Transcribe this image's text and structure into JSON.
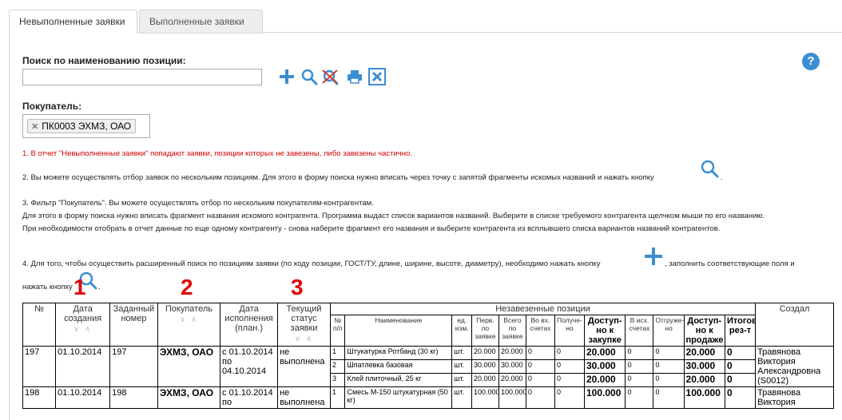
{
  "tabs": [
    "Невыполненные заявки",
    "Выполненные заявки"
  ],
  "search": {
    "label": "Поиск по наименованию позиции:",
    "value": "",
    "placeholder": ""
  },
  "buyer": {
    "label": "Покупатель:",
    "chip": "ПК0003 ЭХМЗ, ОАО"
  },
  "notes": {
    "n1": "1. В отчет \"Невыполненные заявки\" попадают заявки, позиции которых не завезены, либо завезены частично.",
    "n2": "2. Вы можете осуществлять отбор заявок по нескольким позициям. Для этого в форму поиска нужно вписать через точку с запятой фрагменты искомых названий и нажать кнопку",
    "n3a": "3. Фильтр \"Покупатель\". Вы можете осуществлять отбор по нескольким покупателям-контрагентам.",
    "n3b": "Для этого в форму поиска нужно вписать фрагмент названия искомого контрагента. Программа выдаст список вариантов названий. Выберите в списке требуемого контрагента щелчком мыши по его названию.",
    "n3c": "При необходимости отобрать в отчет данные по еще одному контрагенту - снова наберите фрагмент его названия и выберите контрагента из всплывшего списка вариантов названий контрагентов.",
    "n4a": "4. Для того, чтобы осуществить расширенный поиск по позициям заявки (по коду позиции, ГОСТ/ТУ, длине, ширине, высоте, диаметру), необходимо нажать кнопку",
    "n4b": ", заполнить соответствующие поля и",
    "n4c": "нажать кнопку",
    "dot": "."
  },
  "annotations": [
    "1",
    "2",
    "3"
  ],
  "table": {
    "headers": {
      "num": "№",
      "created": "Дата создания",
      "number": "Заданный номер",
      "buyer": "Покупатель",
      "exec_date": "Дата исполнения (план.)",
      "status": "Текущий статус заявки",
      "group": "Незавезенные позиции",
      "author": "Создал",
      "pp": "№ п/п",
      "name": "Наименование",
      "unit": "ед. изм.",
      "first_req": "Перв. по заявке",
      "total_req": "Всего по заявке",
      "in_invoice": "Во вх. счетах",
      "received": "Получе- но",
      "avail_buy": "Доступ- но к закупке",
      "out_invoice": "В исх. счетах",
      "shipped": "Отгруже- но",
      "avail_sell": "Доступ- но к продаже",
      "final_res": "Итоговый рез-т"
    },
    "sort_glyph": "∨ ∧",
    "orders": [
      {
        "num": "197",
        "created": "01.10.2014",
        "number": "197",
        "buyer": "ЭХМЗ, ОАО",
        "exec_date": "с 01.10.2014 по 04.10.2014",
        "status": "не выполнена",
        "author": "Травянова Виктория Александровна (S0012)",
        "items": [
          {
            "pp": "1",
            "name": "Штукатурка Ротбанд (30 кг)",
            "unit": "шт.",
            "first_req": "20.000",
            "total_req": "20.000",
            "in_invoice": "0",
            "received": "0",
            "avail_buy": "20.000",
            "out_invoice": "0",
            "shipped": "0",
            "avail_sell": "20.000",
            "final_res": "0"
          },
          {
            "pp": "2",
            "name": "Шпатлевка базовая",
            "unit": "шт.",
            "first_req": "30.000",
            "total_req": "30.000",
            "in_invoice": "0",
            "received": "0",
            "avail_buy": "30.000",
            "out_invoice": "0",
            "shipped": "0",
            "avail_sell": "30.000",
            "final_res": "0"
          },
          {
            "pp": "3",
            "name": "Клей плиточный, 25 кг",
            "unit": "шт.",
            "first_req": "20.000",
            "total_req": "20.000",
            "in_invoice": "0",
            "received": "0",
            "avail_buy": "20.000",
            "out_invoice": "0",
            "shipped": "0",
            "avail_sell": "20.000",
            "final_res": "0"
          }
        ]
      },
      {
        "num": "198",
        "created": "01.10.2014",
        "number": "198",
        "buyer": "ЭХМЗ, ОАО",
        "exec_date": "с 01.10.2014 по",
        "status": "не выполнена",
        "author": "Травянова Виктория",
        "items": [
          {
            "pp": "1",
            "name": "Смесь М-150 штукатурная (50 кг)",
            "unit": "шт.",
            "first_req": "100.000",
            "total_req": "100.000",
            "in_invoice": "0",
            "received": "0",
            "avail_buy": "100.000",
            "out_invoice": "0",
            "shipped": "0",
            "avail_sell": "100.000",
            "final_res": "0"
          }
        ]
      }
    ]
  },
  "colors": {
    "accent": "#3b8ed2",
    "annotation": "#e00000",
    "warning": "#d00000"
  }
}
